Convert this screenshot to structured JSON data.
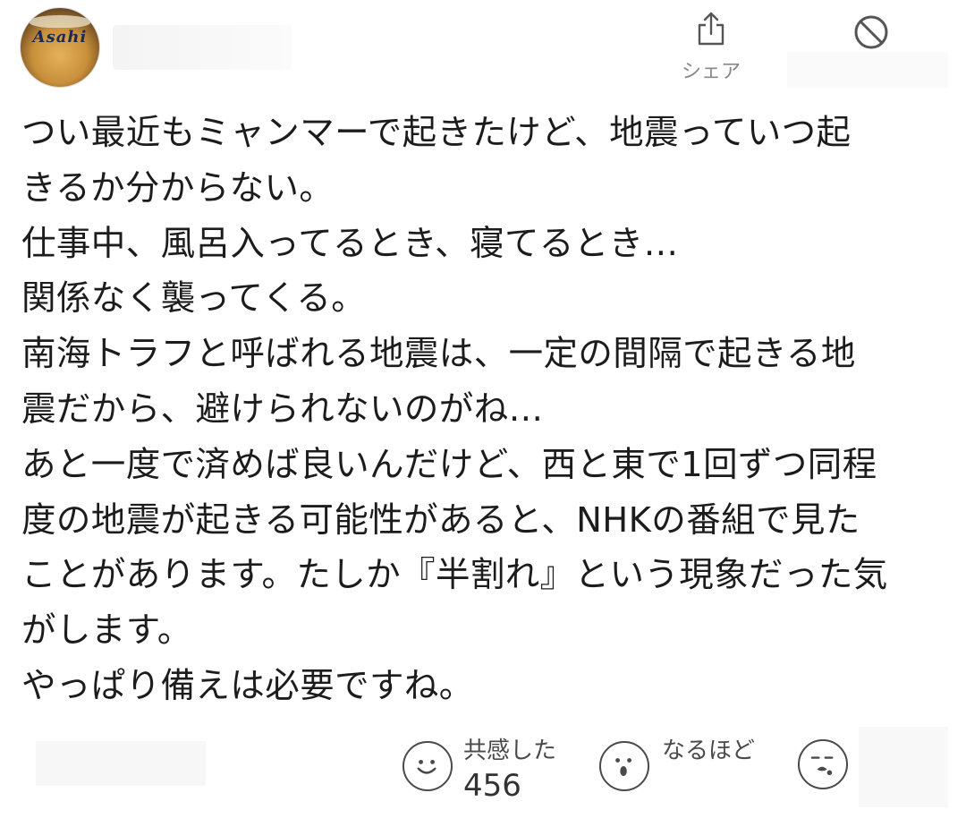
{
  "header": {
    "avatar_logo": "Asahi",
    "share_label": "シェア"
  },
  "comment": {
    "lines": [
      "つい最近もミャンマーで起きたけど、地震っていつ起",
      "きるか分からない。",
      "仕事中、風呂入ってるとき、寝てるとき…",
      "関係なく襲ってくる。",
      "南海トラフと呼ばれる地震は、一定の間隔で起きる地",
      "震だから、避けられないのがね…",
      "あと一度で済めば良いんだけど、西と東で1回ずつ同程",
      "度の地震が起きる可能性があると、NHKの番組で見た",
      "ことがあります。たしか『半割れ』という現象だった気",
      "がします。",
      "やっぱり備えは必要ですね。"
    ]
  },
  "reactions": {
    "empathy": {
      "label": "共感した",
      "count": "456",
      "icon": "smile-face-icon"
    },
    "naruhodo": {
      "label": "なるほど",
      "icon": "surprised-face-icon"
    },
    "third": {
      "icon": "thinking-face-icon"
    }
  },
  "colors": {
    "text": "#1c1c1c",
    "muted": "#888888",
    "icon_stroke": "#4a4a4a"
  }
}
